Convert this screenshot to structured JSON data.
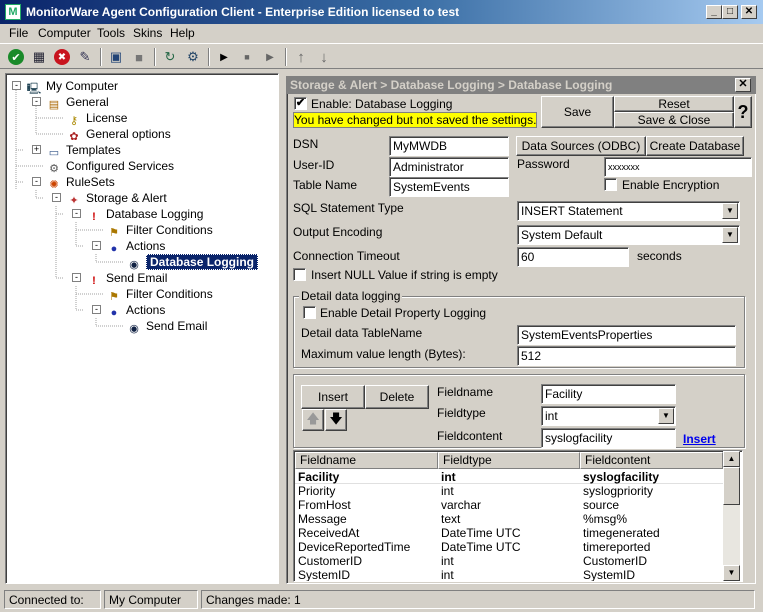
{
  "window": {
    "title": "MonitorWare Agent Configuration Client - Enterprise Edition licensed to test",
    "min_glyph": "_",
    "max_glyph": "□",
    "close_glyph": "✕",
    "app_icon_glyph": "M"
  },
  "menu": [
    "File",
    "Computer",
    "Tools",
    "Skins",
    "Help"
  ],
  "toolbar": {
    "icons": [
      "check-icon",
      "save-icon",
      "cancel-icon",
      "wizard-icon",
      "network-icon",
      "disabled-icon",
      "refresh-icon",
      "config-icon",
      "play-icon",
      "stop-icon",
      "step-icon",
      "up-arrow-icon",
      "down-arrow-icon"
    ],
    "glyphs": {
      "check": "✔",
      "save": "▦",
      "cancel": "✖",
      "wizard": "✎",
      "network": "▣",
      "disabled": "■",
      "refresh": "↻",
      "config": "⚙",
      "play": "▶",
      "stop": "■",
      "step": "▶",
      "up": "↑",
      "down": "↓"
    }
  },
  "tree": {
    "nodes": [
      {
        "label": "My Computer",
        "icon": "computer-icon",
        "glyph": "🖳",
        "expander": "-"
      },
      {
        "label": "General",
        "icon": "general-icon",
        "glyph": "▤",
        "expander": "-"
      },
      {
        "label": "License",
        "icon": "key-icon",
        "glyph": "⚷"
      },
      {
        "label": "General options",
        "icon": "options-icon",
        "glyph": "✿"
      },
      {
        "label": "Templates",
        "icon": "templates-icon",
        "glyph": "▭",
        "expander": "+"
      },
      {
        "label": "Configured Services",
        "icon": "services-icon",
        "glyph": "⚙"
      },
      {
        "label": "RuleSets",
        "icon": "rulesets-icon",
        "glyph": "✺",
        "expander": "-"
      },
      {
        "label": "Storage & Alert",
        "icon": "ruleset-icon",
        "glyph": "✦",
        "expander": "-"
      },
      {
        "label": "Database Logging",
        "icon": "rule-icon",
        "glyph": "!",
        "expander": "-"
      },
      {
        "label": "Filter Conditions",
        "icon": "filter-icon",
        "glyph": "⚑"
      },
      {
        "label": "Actions",
        "icon": "actions-icon",
        "glyph": "●",
        "expander": "-"
      },
      {
        "label": "Database Logging",
        "icon": "action-icon",
        "glyph": "◉"
      },
      {
        "label": "Send Email",
        "icon": "rule-icon",
        "glyph": "!",
        "expander": "-"
      },
      {
        "label": "Filter Conditions",
        "icon": "filter-icon",
        "glyph": "⚑"
      },
      {
        "label": "Actions",
        "icon": "actions-icon",
        "glyph": "●",
        "expander": "-"
      },
      {
        "label": "Send Email",
        "icon": "action-icon",
        "glyph": "◉"
      }
    ]
  },
  "panel": {
    "breadcrumb": "Storage & Alert > Database Logging > Database Logging",
    "close_glyph": "✕",
    "enable_label": "Enable: Database Logging",
    "enable_checked": true,
    "notice": "You have changed but not saved the settings.",
    "save": "Save",
    "reset": "Reset",
    "save_close": "Save & Close",
    "help": "?",
    "dsn_label": "DSN",
    "dsn_value": "MyMWDB",
    "userid_label": "User-ID",
    "userid_value": "Administrator",
    "table_label": "Table Name",
    "table_value": "SystemEvents",
    "odbc_button": "Data Sources (ODBC)",
    "create_db_button": "Create Database",
    "password_label": "Password",
    "password_value": "xxxxxxx",
    "encryption_label": "Enable Encryption",
    "encryption_checked": false,
    "sql_type_label": "SQL Statement Type",
    "sql_type_value": "INSERT Statement",
    "encoding_label": "Output Encoding",
    "encoding_value": "System Default",
    "timeout_label": "Connection Timeout",
    "timeout_value": "60",
    "timeout_unit": "seconds",
    "null_label": "Insert NULL Value if string is empty",
    "null_checked": false,
    "detail_group": "Detail data logging",
    "detail_enable_label": "Enable Detail Property Logging",
    "detail_enable_checked": false,
    "detail_table_label": "Detail data TableName",
    "detail_table_value": "SystemEventsProperties",
    "maxlen_label": "Maximum value length (Bytes):",
    "maxlen_value": "512",
    "insert_button": "Insert",
    "delete_button": "Delete",
    "up_glyph": "🡅",
    "down_glyph": "🡇",
    "fieldname_label": "Fieldname",
    "fieldname_value": "Facility",
    "fieldtype_label": "Fieldtype",
    "fieldtype_value": "int",
    "fieldcontent_label": "Fieldcontent",
    "fieldcontent_value": "syslogfacility",
    "insert_link": "Insert",
    "select_arrow": "▼"
  },
  "grid": {
    "columns": [
      "Fieldname",
      "Fieldtype",
      "Fieldcontent"
    ],
    "rows": [
      [
        "Facility",
        "int",
        "syslogfacility"
      ],
      [
        "Priority",
        "int",
        "syslogpriority"
      ],
      [
        "FromHost",
        "varchar",
        "source"
      ],
      [
        "Message",
        "text",
        "%msg%"
      ],
      [
        "ReceivedAt",
        "DateTime UTC",
        "timegenerated"
      ],
      [
        "DeviceReportedTime",
        "DateTime UTC",
        "timereported"
      ],
      [
        "CustomerID",
        "int",
        "CustomerID"
      ],
      [
        "SystemID",
        "int",
        "SystemID"
      ]
    ],
    "scroll_up": "▲",
    "scroll_down": "▼"
  },
  "status": {
    "connected_label": "Connected to:",
    "computer": "My Computer",
    "changes": "Changes made: 1"
  }
}
